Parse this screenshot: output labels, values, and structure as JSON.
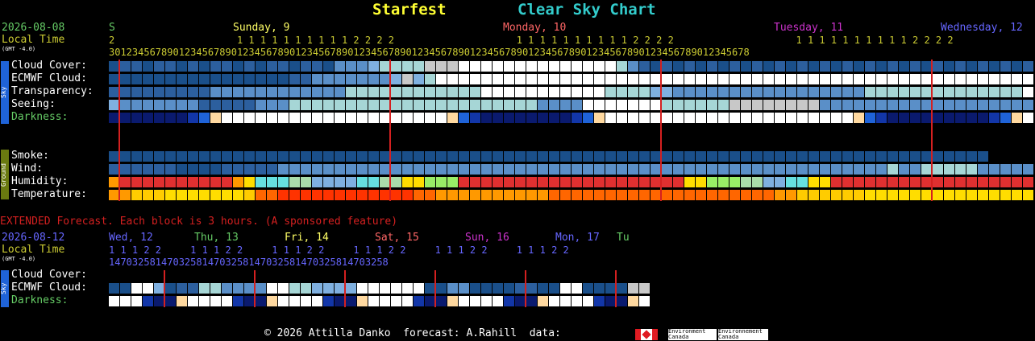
{
  "header": {
    "site_name": "Starfest",
    "chart_name": "Clear Sky Chart",
    "site_color": "#ffff33",
    "chart_color": "#33cccc"
  },
  "dates": {
    "start_date": "2026-08-08",
    "local_time_label": "Local Time",
    "gmt_label": "(GMT -4.0)",
    "days": [
      {
        "label": "S",
        "color": "#66cc66"
      },
      {
        "label": "Sunday, 9",
        "color": "#ffff66"
      },
      {
        "label": "Monday, 10",
        "color": "#ff6666"
      },
      {
        "label": "Tuesday, 11",
        "color": "#cc33cc"
      },
      {
        "label": "Wednesday, 12",
        "color": "#6666ff"
      }
    ],
    "tens_row": "2                     1 1 1 1 1 1 1 1 1 1 2 2 2 2                     1 1 1 1 1 1 1 1 1 1 2 2 2 2                     1 1 1 1 1 1 1 1 1 1 2 2 2 2",
    "ones_row": "30123456789012345678901234567890123456789012345678901234567890123456789012345678901234567890123456789012345678"
  },
  "sky_rows": [
    {
      "label": "Cloud Cover:",
      "colors": "#1a4f8a,#2c5f9e,#2c5f9e,#1a4f8a,#2c5f9e,#2c5f9e,#1a4f8a,#2c5f9e,#1a4f8a,#2c5f9e,#2c5f9e,#1a4f8a,#2c5f9e,#1a4f8a,#2c5f9e,#2c5f9e,#1a4f8a,#2c5f9e,#2c5f9e,#1a4f8a,#5a8fc8,#5a8fc8,#5a8fc8,#7fb0e0,#a6d6d6,#a6d6d6,#a6d6d6,#a6d6d6,#c8c8c8,#c8c8c8,#c8c8c8,#ffffff,#ffffff,#ffffff,#ffffff,#ffffff,#ffffff,#ffffff,#ffffff,#ffffff,#ffffff,#ffffff,#ffffff,#ffffff,#ffffff,#a6d6d6,#5a8fc8,#2c5f9e,#1a4f8a,#2c5f9e,#1a4f8a,#2c5f9e,#1a4f8a,#2c5f9e,#1a4f8a,#2c5f9e,#1a4f8a,#2c5f9e,#1a4f8a,#2c5f9e,#1a4f8a,#2c5f9e,#1a4f8a,#2c5f9e,#1a4f8a,#2c5f9e,#1a4f8a,#2c5f9e,#1a4f8a,#2c5f9e,#1a4f8a,#2c5f9e,#1a4f8a,#2c5f9e,#1a4f8a,#2c5f9e,#1a4f8a,#2c5f9e,#1a4f8a,#2c5f9e,#1a4f8a,#2c5f9e,#1a4f8a,#2c5f9e,#1a4f8a,#2c5f9e,#1a4f8a,#2c5f9e,#1a4f8a,#2c5f9e,#1a4f8a,#2c5f9e,#1a4f8a,#2c5f9e,#1a4f8a,#2c5f9e,#1a4f8a,#2c5f9e,#1a4f8a,#2c5f9e,#1a4f8a,#2c5f9e,#1a4f8a,#2c5f9e,#5a8fc8,#ffffff,#ffffff,#ffffff,#a6d6d6,#ffffff"
    },
    {
      "label": "ECMWF Cloud:",
      "colors": "#1a4f8a,#1a4f8a,#1a4f8a,#1a4f8a,#1a4f8a,#1a4f8a,#1a4f8a,#1a4f8a,#1a4f8a,#1a4f8a,#1a4f8a,#1a4f8a,#1a4f8a,#1a4f8a,#1a4f8a,#1a4f8a,#2c5f9e,#2c5f9e,#5a8fc8,#5a8fc8,#5a8fc8,#5a8fc8,#5a8fc8,#5a8fc8,#5a8fc8,#7fb0e0,#c8c8c8,#7fb0e0,#a6d6d6,#ffffff,#ffffff,#ffffff,#ffffff,#ffffff,#ffffff,#ffffff,#ffffff,#ffffff,#ffffff,#ffffff,#ffffff,#ffffff,#ffffff,#ffffff,#ffffff,#ffffff,#ffffff,#ffffff,#ffffff,#ffffff,#ffffff,#ffffff,#ffffff,#ffffff,#ffffff,#ffffff,#ffffff,#ffffff,#ffffff,#ffffff,#ffffff,#ffffff,#ffffff,#ffffff,#ffffff,#ffffff,#ffffff,#ffffff,#ffffff,#ffffff,#ffffff,#ffffff,#ffffff,#ffffff,#ffffff,#ffffff,#ffffff,#ffffff,#ffffff,#ffffff,#ffffff,#ffffff,#ffffff,#ffffff,#5a8fc8,#a6d6d6,#1a4f8a,#1a4f8a,#1a4f8a,#1a4f8a,#1a4f8a,#5a8fc8,#5a8fc8,#5a8fc8,#5a8fc8,#5a8fc8,#5a8fc8,#1a4f8a,#1a4f8a,#1a4f8a,#1a4f8a,#1a4f8a,#1a4f8a,#1a4f8a,#2c5f9e,#2c5f9e,#2c5f9e,#2c5f9e,#2c5f9e,#2c5f9e,#2c5f9e"
    },
    {
      "label": "Transparency:",
      "colors": "#2c5f9e,#2c5f9e,#2c5f9e,#2c5f9e,#2c5f9e,#2c5f9e,#2c5f9e,#2c5f9e,#2c5f9e,#5a8fc8,#5a8fc8,#5a8fc8,#5a8fc8,#5a8fc8,#5a8fc8,#5a8fc8,#5a8fc8,#5a8fc8,#5a8fc8,#5a8fc8,#5a8fc8,#a6d6d6,#a6d6d6,#a6d6d6,#a6d6d6,#a6d6d6,#a6d6d6,#a6d6d6,#a6d6d6,#a6d6d6,#a6d6d6,#a6d6d6,#a6d6d6,#ffffff,#ffffff,#ffffff,#ffffff,#ffffff,#ffffff,#ffffff,#ffffff,#ffffff,#ffffff,#ffffff,#a6d6d6,#a6d6d6,#a6d6d6,#a6d6d6,#7fb0e0,#7fb0e0,#5a8fc8,#5a8fc8,#5a8fc8,#5a8fc8,#5a8fc8,#5a8fc8,#5a8fc8,#5a8fc8,#5a8fc8,#5a8fc8,#5a8fc8,#5a8fc8,#5a8fc8,#5a8fc8,#5a8fc8,#5a8fc8,#5a8fc8,#a6d6d6,#a6d6d6,#a6d6d6,#a6d6d6,#a6d6d6,#a6d6d6,#a6d6d6,#a6d6d6,#a6d6d6,#a6d6d6,#a6d6d6,#a6d6d6,#a6d6d6,#a6d6d6,#ffffff,#ffffff,#a6d6d6,#5a8fc8,#5a8fc8,#5a8fc8,#5a8fc8,#5a8fc8,#5a8fc8,#5a8fc8,#5a8fc8,#5a8fc8,#5a8fc8,#5a8fc8,#5a8fc8,#5a8fc8,#5a8fc8,#5a8fc8,#5a8fc8,#5a8fc8,#5a8fc8,#5a8fc8,#5a8fc8,#5a8fc8,#5a8fc8,#ffffff,#ffffff,#ffffff,#ffffff,#ffffff"
    },
    {
      "label": "Seeing:",
      "colors": "#7fb0e0,#5a8fc8,#5a8fc8,#5a8fc8,#5a8fc8,#5a8fc8,#5a8fc8,#5a8fc8,#2c5f9e,#2c5f9e,#2c5f9e,#2c5f9e,#2c5f9e,#5a8fc8,#5a8fc8,#5a8fc8,#a6d6d6,#a6d6d6,#a6d6d6,#a6d6d6,#a6d6d6,#a6d6d6,#a6d6d6,#a6d6d6,#a6d6d6,#a6d6d6,#a6d6d6,#a6d6d6,#a6d6d6,#a6d6d6,#a6d6d6,#a6d6d6,#a6d6d6,#a6d6d6,#a6d6d6,#a6d6d6,#a6d6d6,#a6d6d6,#5a8fc8,#5a8fc8,#5a8fc8,#5a8fc8,#ffffff,#ffffff,#ffffff,#ffffff,#ffffff,#ffffff,#ffffff,#a6d6d6,#a6d6d6,#a6d6d6,#a6d6d6,#a6d6d6,#a6d6d6,#c8c8c8,#c8c8c8,#c8c8c8,#c8c8c8,#c8c8c8,#c8c8c8,#c8c8c8,#c8c8c8,#5a8fc8,#5a8fc8,#5a8fc8,#5a8fc8,#5a8fc8,#5a8fc8,#5a8fc8,#5a8fc8,#5a8fc8,#5a8fc8,#5a8fc8,#5a8fc8,#5a8fc8,#5a8fc8,#5a8fc8,#5a8fc8,#5a8fc8,#5a8fc8,#5a8fc8,#a6d6d6,#a6d6d6,#a6d6d6,#a6d6d6,#a6d6d6,#a6d6d6,#a6d6d6,#a6d6d6,#a6d6d6,#a6d6d6,#a6d6d6,#a6d6d6,#a6d6d6,#a6d6d6,#5a8fc8,#5a8fc8,#5a8fc8,#5a8fc8,#5a8fc8,#5a8fc8,#5a8fc8,#5a8fc8,#5a8fc8,#5a8fc8,#5a8fc8,#5a8fc8,#ffffff,#ffffff,#ffffff,#5a8fc8,#5a8fc8"
    },
    {
      "label": "Darkness:",
      "colors": "#0a1a6e,#0a1a6e,#0a1a6e,#0a1a6e,#0a1a6e,#0a1a6e,#0a1a6e,#1236a8,#1f63d8,#ffd9a0,#ffffff,#ffffff,#ffffff,#ffffff,#ffffff,#ffffff,#ffffff,#ffffff,#ffffff,#ffffff,#ffffff,#ffffff,#ffffff,#ffffff,#ffffff,#ffffff,#ffffff,#ffffff,#ffffff,#ffffff,#ffd9a0,#1f63d8,#1236a8,#0a1a6e,#0a1a6e,#0a1a6e,#0a1a6e,#0a1a6e,#0a1a6e,#0a1a6e,#0a1a6e,#1236a8,#1f63d8,#ffd9a0,#ffffff,#ffffff,#ffffff,#ffffff,#ffffff,#ffffff,#ffffff,#ffffff,#ffffff,#ffffff,#ffffff,#ffffff,#ffffff,#ffffff,#ffffff,#ffffff,#ffffff,#ffffff,#ffffff,#ffffff,#ffffff,#ffffff,#ffd9a0,#1f63d8,#1236a8,#0a1a6e,#0a1a6e,#0a1a6e,#0a1a6e,#0a1a6e,#0a1a6e,#0a1a6e,#0a1a6e,#0a1a6e,#1236a8,#1f63d8,#ffd9a0,#ffffff,#ffffff,#ffffff,#ffffff,#ffffff,#ffffff,#ffffff,#ffffff,#ffffff,#ffffff,#ffffff,#ffffff,#ffffff,#ffffff,#ffffff,#ffffff,#ffffff,#ffffff,#ffffff,#ffffff,#ffffff,#ffd9a0,#1f63d8,#1236a8,#0a1a6e,#0a1a6e,#0a1a6e,#0a1a6e,#0a1a6e,#0a1a6e,#0a1a6e,#0a1a6e,#1236a8,#1f63d8,#ffd9a0,#ffffff,#ffffff"
    }
  ],
  "ground_rows": [
    {
      "label": "Smoke:",
      "colors": "#1a4f8a,#1a4f8a,#1a4f8a,#1a4f8a,#1a4f8a,#1a4f8a,#1a4f8a,#1a4f8a,#1a4f8a,#1a4f8a,#1a4f8a,#1a4f8a,#1a4f8a,#1a4f8a,#1a4f8a,#1a4f8a,#1a4f8a,#1a4f8a,#1a4f8a,#1a4f8a,#1a4f8a,#1a4f8a,#1a4f8a,#1a4f8a,#1a4f8a,#1a4f8a,#1a4f8a,#1a4f8a,#1a4f8a,#1a4f8a,#1a4f8a,#1a4f8a,#1a4f8a,#1a4f8a,#1a4f8a,#1a4f8a,#1a4f8a,#1a4f8a,#1a4f8a,#1a4f8a,#1a4f8a,#1a4f8a,#1a4f8a,#1a4f8a,#1a4f8a,#1a4f8a,#1a4f8a,#1a4f8a,#1a4f8a,#1a4f8a,#1a4f8a,#1a4f8a,#1a4f8a,#1a4f8a,#1a4f8a,#1a4f8a,#1a4f8a,#1a4f8a,#1a4f8a,#1a4f8a,#1a4f8a,#1a4f8a,#1a4f8a,#1a4f8a,#1a4f8a,#1a4f8a,#1a4f8a,#1a4f8a,#1a4f8a,#1a4f8a,#1a4f8a,#1a4f8a,#1a4f8a,#1a4f8a,#1a4f8a,#1a4f8a,#1a4f8a,#1a4f8a"
    },
    {
      "label": "Wind:",
      "colors": "#2c5f9e,#2c5f9e,#2c5f9e,#2c5f9e,#2c5f9e,#2c5f9e,#1a4f8a,#1a4f8a,#1a4f8a,#1a4f8a,#2c5f9e,#2c5f9e,#2c5f9e,#2c5f9e,#2c5f9e,#5a8fc8,#5a8fc8,#5a8fc8,#5a8fc8,#5a8fc8,#5a8fc8,#5a8fc8,#5a8fc8,#5a8fc8,#5a8fc8,#5a8fc8,#5a8fc8,#5a8fc8,#5a8fc8,#5a8fc8,#5a8fc8,#5a8fc8,#5a8fc8,#5a8fc8,#5a8fc8,#5a8fc8,#5a8fc8,#5a8fc8,#5a8fc8,#5a8fc8,#5a8fc8,#5a8fc8,#5a8fc8,#5a8fc8,#5a8fc8,#5a8fc8,#5a8fc8,#5a8fc8,#5a8fc8,#5a8fc8,#5a8fc8,#5a8fc8,#5a8fc8,#5a8fc8,#5a8fc8,#5a8fc8,#5a8fc8,#5a8fc8,#5a8fc8,#5a8fc8,#5a8fc8,#5a8fc8,#5a8fc8,#5a8fc8,#5a8fc8,#5a8fc8,#5a8fc8,#5a8fc8,#5a8fc8,#a6d6d6,#5a8fc8,#5a8fc8,#a6d6d6,#a6d6d6,#a6d6d6,#a6d6d6,#a6d6d6,#5a8fc8,#5a8fc8,#5a8fc8,#5a8fc8,#5a8fc8,#5a8fc8,#5a8fc8,#5a8fc8,#5a8fc8,#2c5f9e,#2c5f9e,#2c5f9e,#2c5f9e,#2c5f9e,#5a8fc8,#5a8fc8,#5a8fc8,#5a8fc8,#5a8fc8,#5a8fc8,#5a8fc8,#5a8fc8,#2c5f9e,#2c5f9e,#2c5f9e,#2c5f9e,#2c5f9e,#2c5f9e,#2c5f9e,#2c5f9e,#2c5f9e,#2c5f9e,#2c5f9e,#2c5f9e"
    },
    {
      "label": "Humidity:",
      "colors": "#ff9900,#e03030,#e03030,#e03030,#e03030,#e03030,#e03030,#e03030,#e03030,#e03030,#e03030,#ff9900,#ffdd00,#66e0e0,#66e0e0,#66e0e0,#aaddaa,#aaddaa,#7fb0e0,#7fb0e0,#7fb0e0,#7fb0e0,#66e0e0,#66e0e0,#aaddaa,#aaddaa,#ffdd00,#ffdd00,#99ee66,#99ee66,#99ee66,#e03030,#e03030,#e03030,#e03030,#e03030,#e03030,#e03030,#e03030,#e03030,#e03030,#e03030,#e03030,#e03030,#e03030,#e03030,#e03030,#e03030,#e03030,#e03030,#e03030,#ffdd00,#ffdd00,#99ee66,#99ee66,#99ee66,#aaddaa,#aaddaa,#7fb0e0,#7fb0e0,#66e0e0,#66e0e0,#ffdd00,#ffdd00,#e03030,#e03030,#e03030,#e03030,#e03030,#e03030,#e03030,#e03030,#e03030,#e03030,#e03030,#e03030,#e03030,#e03030,#e03030,#e03030,#e03030,#e03030,#e03030,#ffdd00,#ffdd00,#66e0e0,#66e0e0,#7fb0e0,#7fb0e0,#7fb0e0,#7fb0e0,#aaddaa,#aaddaa,#aaddaa,#66e0e0,#66e0e0,#ffdd00,#ffdd00,#ffdd00,#ffdd00,#ffdd00,#ffdd00,#ffdd00,#ffdd00,#ffdd00,#ffdd00,#ffdd00,#ffdd00,#ffdd00,#ffdd00,#ffdd00"
    },
    {
      "label": "Temperature:",
      "colors": "#ff9900,#ff9900,#ffcc00,#ffcc00,#ffcc00,#ffdd00,#ffdd00,#ffdd00,#ffdd00,#ffdd00,#ffdd00,#ffdd00,#ffcc00,#ff6600,#ff6600,#ff3300,#ff3300,#ff3300,#ff3300,#ff3300,#ff3300,#ff3300,#ff3300,#ff3300,#ff3300,#ff3300,#ff3300,#ff6600,#ff6600,#ff9900,#ff9900,#ff9900,#ff9900,#ff9900,#ff9900,#ff9900,#ff9900,#ff9900,#ff9900,#ff6600,#ff6600,#ff6600,#ff6600,#ff6600,#ff6600,#ff6600,#ff6600,#ff6600,#ff6600,#ff6600,#ff6600,#ff6600,#ff6600,#ff6600,#ff6600,#ff6600,#ff6600,#ff6600,#ff6600,#ff9900,#ff9900,#ffcc00,#ffcc00,#ffcc00,#ffcc00,#ffcc00,#ffcc00,#ffdd00,#ffdd00,#ffdd00,#ffdd00,#ffdd00,#ffdd00,#ffdd00,#ffdd00,#ffdd00,#ffdd00,#ffdd00,#ffdd00,#ffdd00,#ffdd00,#ffdd00,#ff9900,#ff6600,#ff6600,#ff6600,#ff3300,#ff3300,#ff3300,#ff3300,#ff3300,#ff3300,#ff3300,#ff3300,#ff3300,#ff6600,#ff6600,#ff9900,#ffcc00,#ffcc00,#ffcc00,#ffdd00,#ffdd00,#ffdd00,#ffdd00,#ffdd00,#ffdd00,#ffdd00,#ffdd00,#ffdd00,#ffdd00"
    }
  ],
  "extended": {
    "heading": "EXTENDED Forecast. Each block is 3 hours. (A sponsored feature)",
    "start_date": "2026-08-12",
    "local_time_label": "Local Time",
    "gmt_label": "(GMT -4.0)",
    "days": [
      {
        "label": "Wed, 12",
        "color": "#6666ff"
      },
      {
        "label": "Thu, 13",
        "color": "#66cc66"
      },
      {
        "label": "Fri, 14",
        "color": "#ffff66"
      },
      {
        "label": "Sat, 15",
        "color": "#ff6666"
      },
      {
        "label": "Sun, 16",
        "color": "#cc33cc"
      },
      {
        "label": "Mon, 17",
        "color": "#6666ff"
      },
      {
        "label": "Tu",
        "color": "#66cc66"
      }
    ],
    "tens_row": "1 1 1 2 2     1 1 1 2 2     1 1 1 2 2     1 1 1 2 2     1 1 1 2 2     1 1 1 2 2",
    "ones_row": "147032581470325814703258147032581470325814703258",
    "rows": [
      {
        "label": "Cloud Cover:",
        "colors": "#1a4f8a,#1a4f8a,#ffffff,#ffffff,#7fb0e0,#1a4f8a,#2c5f9e,#2c5f9e,#a6d6d6,#a6d6d6,#5a8fc8,#5a8fc8,#5a8fc8,#5a8fc8,#ffffff,#ffffff,#a6d6d6,#a6d6d6,#7fb0e0,#7fb0e0,#7fb0e0,#7fb0e0,#ffffff,#ffffff,#ffffff,#ffffff,#ffffff,#ffffff,#1a4f8a,#1a4f8a,#5a8fc8,#5a8fc8,#1a4f8a,#1a4f8a,#1a4f8a,#1a4f8a,#2c5f9e,#2c5f9e,#1a4f8a,#1a4f8a,#ffffff,#ffffff,#1a4f8a,#1a4f8a,#1a4f8a,#1a4f8a,#c8c8c8,#c8c8c8"
      },
      {
        "label": "ECMWF Cloud:",
        "colors": ""
      },
      {
        "label": "Darkness:",
        "colors": "#ffffff,#ffffff,#ffffff,#1236a8,#0a1a6e,#0a1a6e,#ffd9a0,#ffffff,#ffffff,#ffffff,#ffffff,#1236a8,#0a1a6e,#0a1a6e,#ffd9a0,#ffffff,#ffffff,#ffffff,#ffffff,#1236a8,#0a1a6e,#0a1a6e,#ffd9a0,#ffffff,#ffffff,#ffffff,#ffffff,#1236a8,#0a1a6e,#0a1a6e,#ffd9a0,#ffffff,#ffffff,#ffffff,#ffffff,#1236a8,#0a1a6e,#0a1a6e,#ffd9a0,#ffffff,#ffffff,#ffffff,#ffffff,#1236a8,#0a1a6e,#0a1a6e,#ffd9a0,#ffffff"
      }
    ]
  },
  "side_tags": {
    "sky": "Sky",
    "ground": "Ground"
  },
  "footer": {
    "text": "© 2026 Attilla Danko  forecast: A.Rahill  data:",
    "logo_text_en": "Environment Canada",
    "logo_text_fr": "Environnement Canada"
  }
}
